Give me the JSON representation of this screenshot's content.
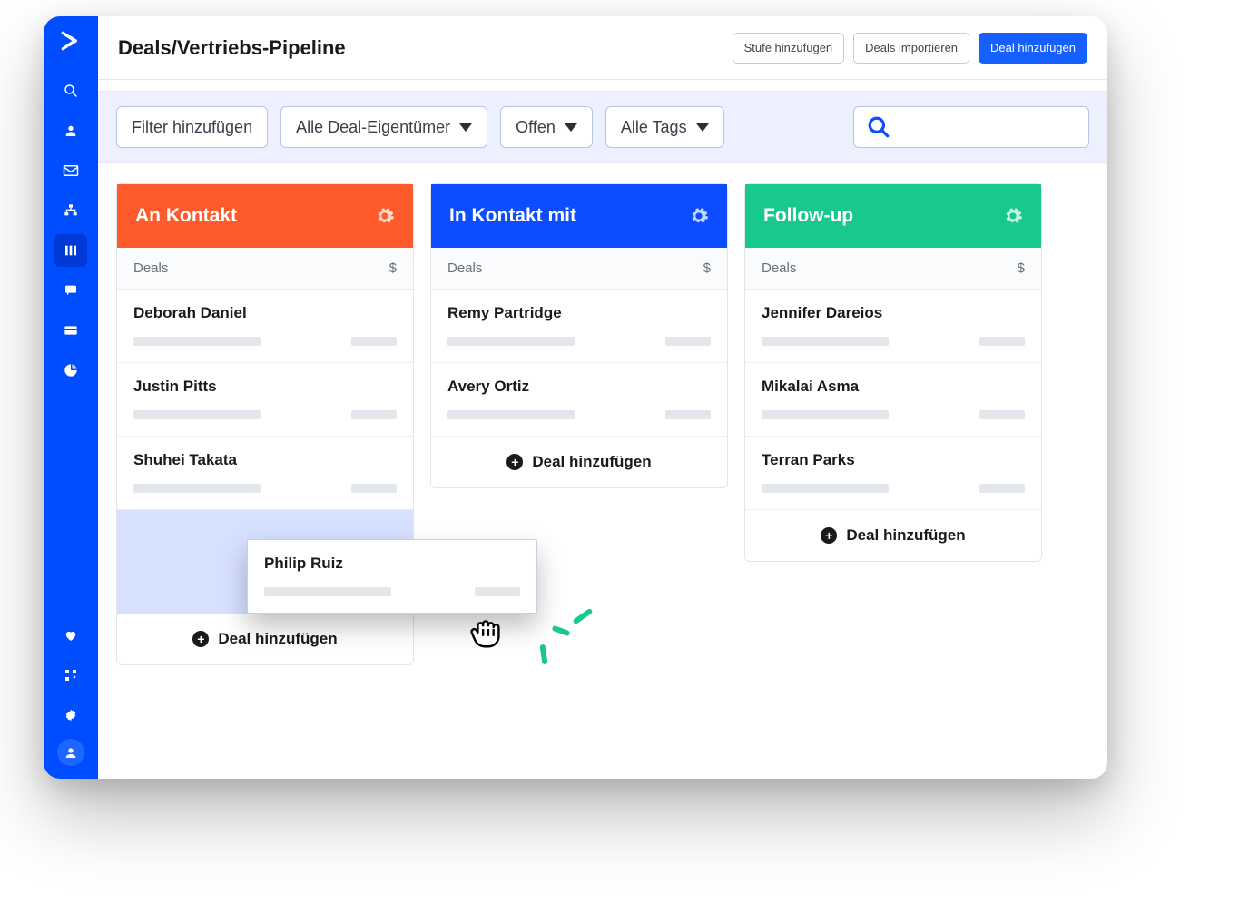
{
  "colors": {
    "primary": "#004cff",
    "orange": "#ff5a2b",
    "blue": "#0d4dff",
    "green": "#19c88e"
  },
  "header": {
    "title": "Deals/Vertriebs-Pipeline",
    "buttons": {
      "add_stage": "Stufe hinzufügen",
      "import": "Deals importieren",
      "add_deal": "Deal hinzufügen"
    }
  },
  "filters": {
    "add_filter": "Filter hinzufügen",
    "owner": "Alle Deal-Eigentümer",
    "status": "Offen",
    "tags": "Alle Tags"
  },
  "columns": {
    "sub_label": "Deals",
    "currency": "$",
    "add_deal_label": "Deal hinzufügen",
    "list": [
      {
        "title": "An Kontakt",
        "color": "h-orange",
        "cards": [
          "Deborah Daniel",
          "Justin Pitts",
          "Shuhei Takata"
        ],
        "has_dropzone": true
      },
      {
        "title": "In Kontakt mit",
        "color": "h-blue",
        "cards": [
          "Remy Partridge",
          "Avery Ortiz"
        ],
        "has_dropzone": false
      },
      {
        "title": "Follow-up",
        "color": "h-green",
        "cards": [
          "Jennifer Dareios",
          "Mikalai Asma",
          "Terran Parks"
        ],
        "has_dropzone": false
      }
    ]
  },
  "drag_card": {
    "name": "Philip Ruiz"
  },
  "sidebar": {
    "icons": [
      "search",
      "person",
      "mail",
      "org",
      "pipeline",
      "chat",
      "card",
      "pie"
    ],
    "active_index": 4,
    "bottom": [
      "heart",
      "apps",
      "gear"
    ]
  }
}
